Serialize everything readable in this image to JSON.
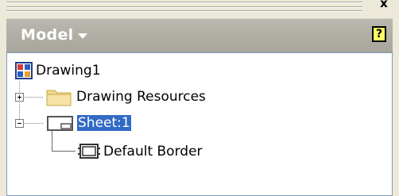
{
  "window": {
    "close_glyph": "x"
  },
  "header": {
    "title": "Model",
    "help_glyph": "?"
  },
  "tree": {
    "root": {
      "label": "Drawing1",
      "icon": "drawing-icon"
    },
    "items": [
      {
        "label": "Drawing Resources",
        "icon": "folder-icon",
        "expanded": false
      },
      {
        "label": "Sheet:1",
        "icon": "sheet-icon",
        "expanded": true,
        "selected": true
      },
      {
        "label": "Default Border",
        "icon": "border-icon"
      }
    ]
  },
  "colors": {
    "header_bg": "#b0aea5",
    "selection": "#316ac5",
    "folder": "#f4d98c"
  }
}
